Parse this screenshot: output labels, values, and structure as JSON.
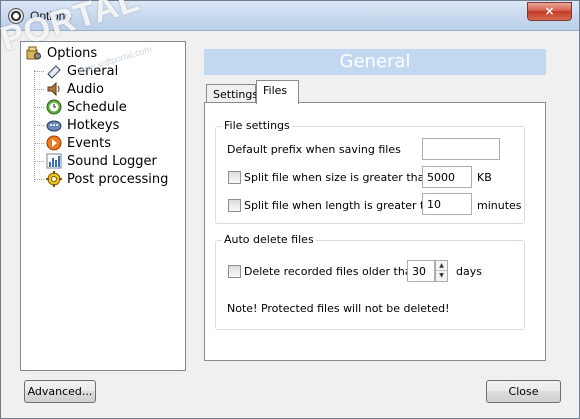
{
  "window": {
    "title": "Options",
    "close_glyph": "×",
    "watermark": "PORTAL",
    "watermark_small": "www.softportal.com"
  },
  "tree": {
    "root": {
      "label": "Options",
      "icon": "options-icon"
    },
    "items": [
      {
        "label": "General",
        "icon": "general-icon"
      },
      {
        "label": "Audio",
        "icon": "audio-icon"
      },
      {
        "label": "Schedule",
        "icon": "schedule-icon"
      },
      {
        "label": "Hotkeys",
        "icon": "hotkeys-icon"
      },
      {
        "label": "Events",
        "icon": "events-icon"
      },
      {
        "label": "Sound Logger",
        "icon": "sound-logger-icon"
      },
      {
        "label": "Post processing",
        "icon": "post-processing-icon"
      }
    ]
  },
  "panel": {
    "header": "General",
    "tabs": [
      {
        "label": "Settings",
        "active": false
      },
      {
        "label": "Files",
        "active": true
      }
    ]
  },
  "file_settings": {
    "title": "File settings",
    "prefix_label": "Default prefix when saving files",
    "prefix_value": "",
    "split_size_label": "Split file when size is greater than",
    "split_size_checked": false,
    "split_size_value": "5000",
    "split_size_unit": "KB",
    "split_length_label": "Split file when length is greater than",
    "split_length_checked": false,
    "split_length_value": "10",
    "split_length_unit": "minutes"
  },
  "auto_delete": {
    "title": "Auto delete files",
    "delete_label": "Delete recorded files older than",
    "delete_checked": false,
    "delete_value": "30",
    "delete_unit": "days",
    "note": "Note! Protected files will not be deleted!"
  },
  "footer": {
    "advanced_label": "Advanced...",
    "close_label": "Close"
  },
  "colors": {
    "header_bar": "#c2d8f0",
    "title_bar": "#c6d7ee",
    "close_button": "#c33a24"
  }
}
